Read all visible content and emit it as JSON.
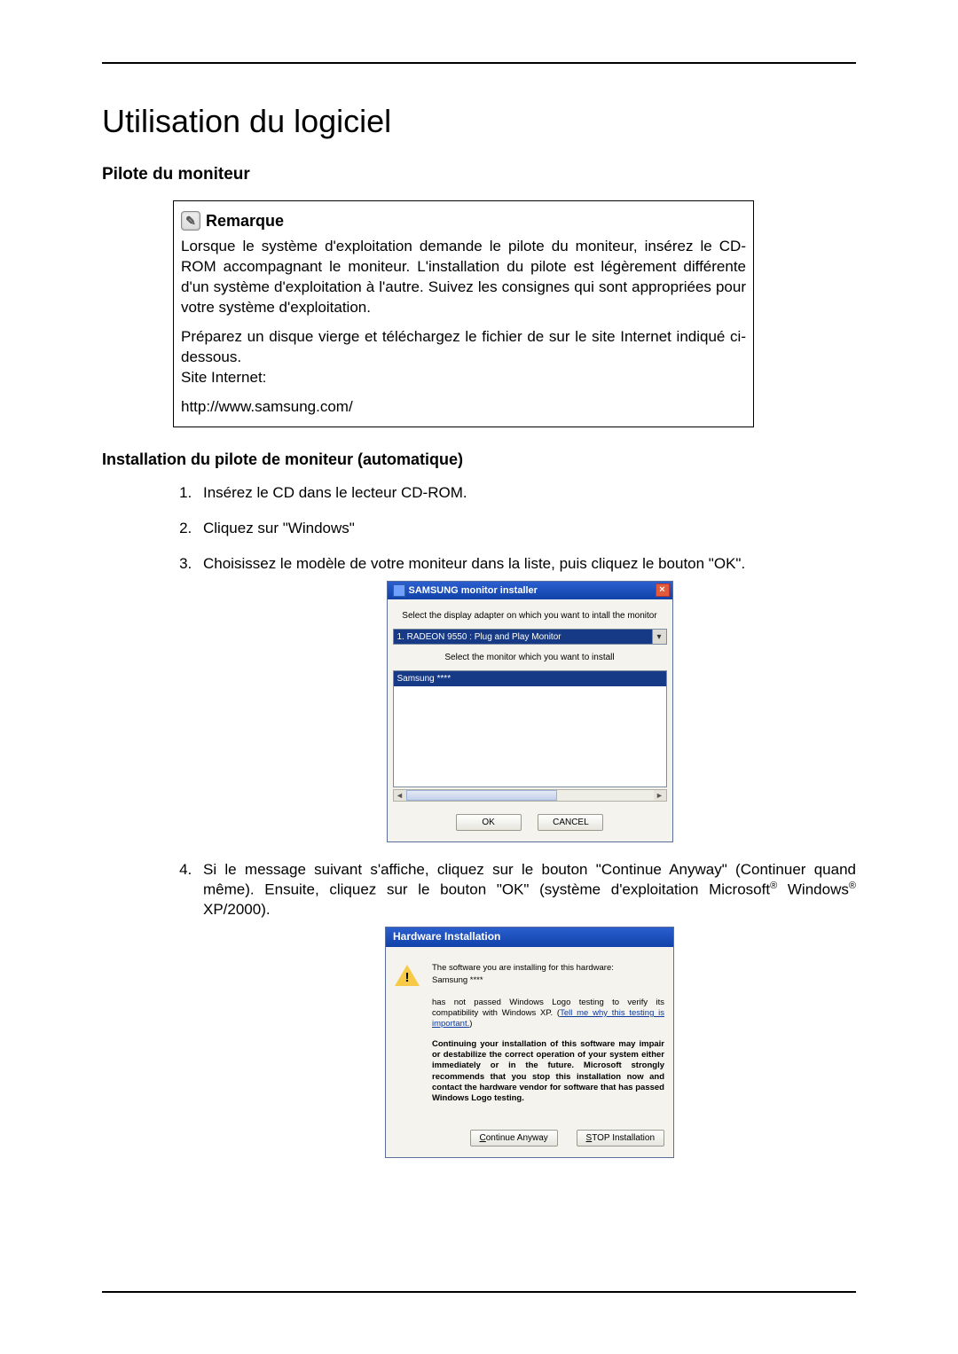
{
  "page": {
    "title": "Utilisation du logiciel",
    "h2": "Pilote du moniteur",
    "h3": "Installation du pilote de moniteur (automatique)"
  },
  "note": {
    "heading": "Remarque",
    "p1": "Lorsque le système d'exploitation demande le pilote du moniteur, insérez le CD-ROM accompagnant le moniteur. L'installation du pilote est légèrement différente d'un système d'exploitation à l'autre. Suivez les consignes qui sont appropriées pour votre système d'exploitation.",
    "p2": "Préparez un disque vierge et téléchargez le fichier de sur le site Internet indiqué ci-dessous.",
    "site_label": "Site Internet:",
    "url": "http://www.samsung.com/"
  },
  "steps": {
    "s1": "Insérez le CD dans le lecteur CD-ROM.",
    "s2": "Cliquez sur \"Windows\"",
    "s3": "Choisissez le modèle de votre moniteur dans la liste, puis cliquez le bouton \"OK\".",
    "s4a": "Si le message suivant s'affiche, cliquez sur le bouton \"Continue Anyway\" (Continuer quand même). Ensuite, cliquez sur le bouton \"OK\" (système d'exploitation Microsoft",
    "s4b": " Windows",
    "s4c": " XP/2000)."
  },
  "dlg1": {
    "title": "SAMSUNG monitor installer",
    "prompt1": "Select the display adapter on which you want to intall the monitor",
    "select_value": "1. RADEON 9550 : Plug and Play Monitor",
    "prompt2": "Select the monitor which you want to install",
    "list_selected": "Samsung ****",
    "ok": "OK",
    "cancel": "CANCEL"
  },
  "dlg2": {
    "title": "Hardware Installation",
    "line1": "The software you are installing for this hardware:",
    "hwname": "Samsung ****",
    "line2a": "has not passed Windows Logo testing to verify its compatibility with Windows XP. (",
    "link": "Tell me why this testing is important.",
    "line2b": ")",
    "bold": "Continuing your installation of this software may impair or destabilize the correct operation of your system either immediately or in the future. Microsoft strongly recommends that you stop this installation now and contact the hardware vendor for software that has passed Windows Logo testing.",
    "btn_continue_u": "C",
    "btn_continue_rest": "ontinue Anyway",
    "btn_stop_u": "S",
    "btn_stop_rest": "TOP Installation"
  }
}
